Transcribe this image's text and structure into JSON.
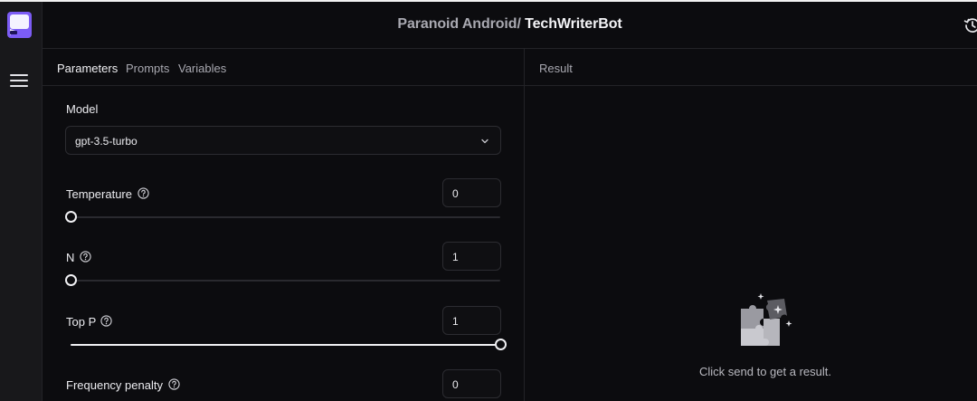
{
  "header": {
    "crumb": "Paranoid Android/",
    "current": " TechWriterBot"
  },
  "tabs": [
    {
      "label": "Parameters",
      "active": true
    },
    {
      "label": "Prompts",
      "active": false
    },
    {
      "label": "Variables",
      "active": false
    }
  ],
  "result": {
    "label": "Result",
    "empty_message": "Click send to get a result."
  },
  "params": {
    "model": {
      "label": "Model",
      "value": "gpt-3.5-turbo"
    },
    "temperature": {
      "label": "Temperature",
      "value": "0",
      "level": 0
    },
    "n": {
      "label": "N",
      "value": "1",
      "level": 0
    },
    "top_p": {
      "label": "Top P",
      "value": "1",
      "level": 1
    },
    "frequency_penalty": {
      "label": "Frequency penalty",
      "value": "0"
    }
  },
  "icons": {
    "logo": "chat-bubble-logo",
    "menu": "hamburger-menu-icon",
    "history": "history-icon",
    "help": "question-circle-icon",
    "chevron": "chevron-down-icon",
    "empty": "puzzle-pieces-icon"
  },
  "colors": {
    "brand": "#7c5cf5",
    "background": "#0c0c0f",
    "rail": "#18181b"
  }
}
